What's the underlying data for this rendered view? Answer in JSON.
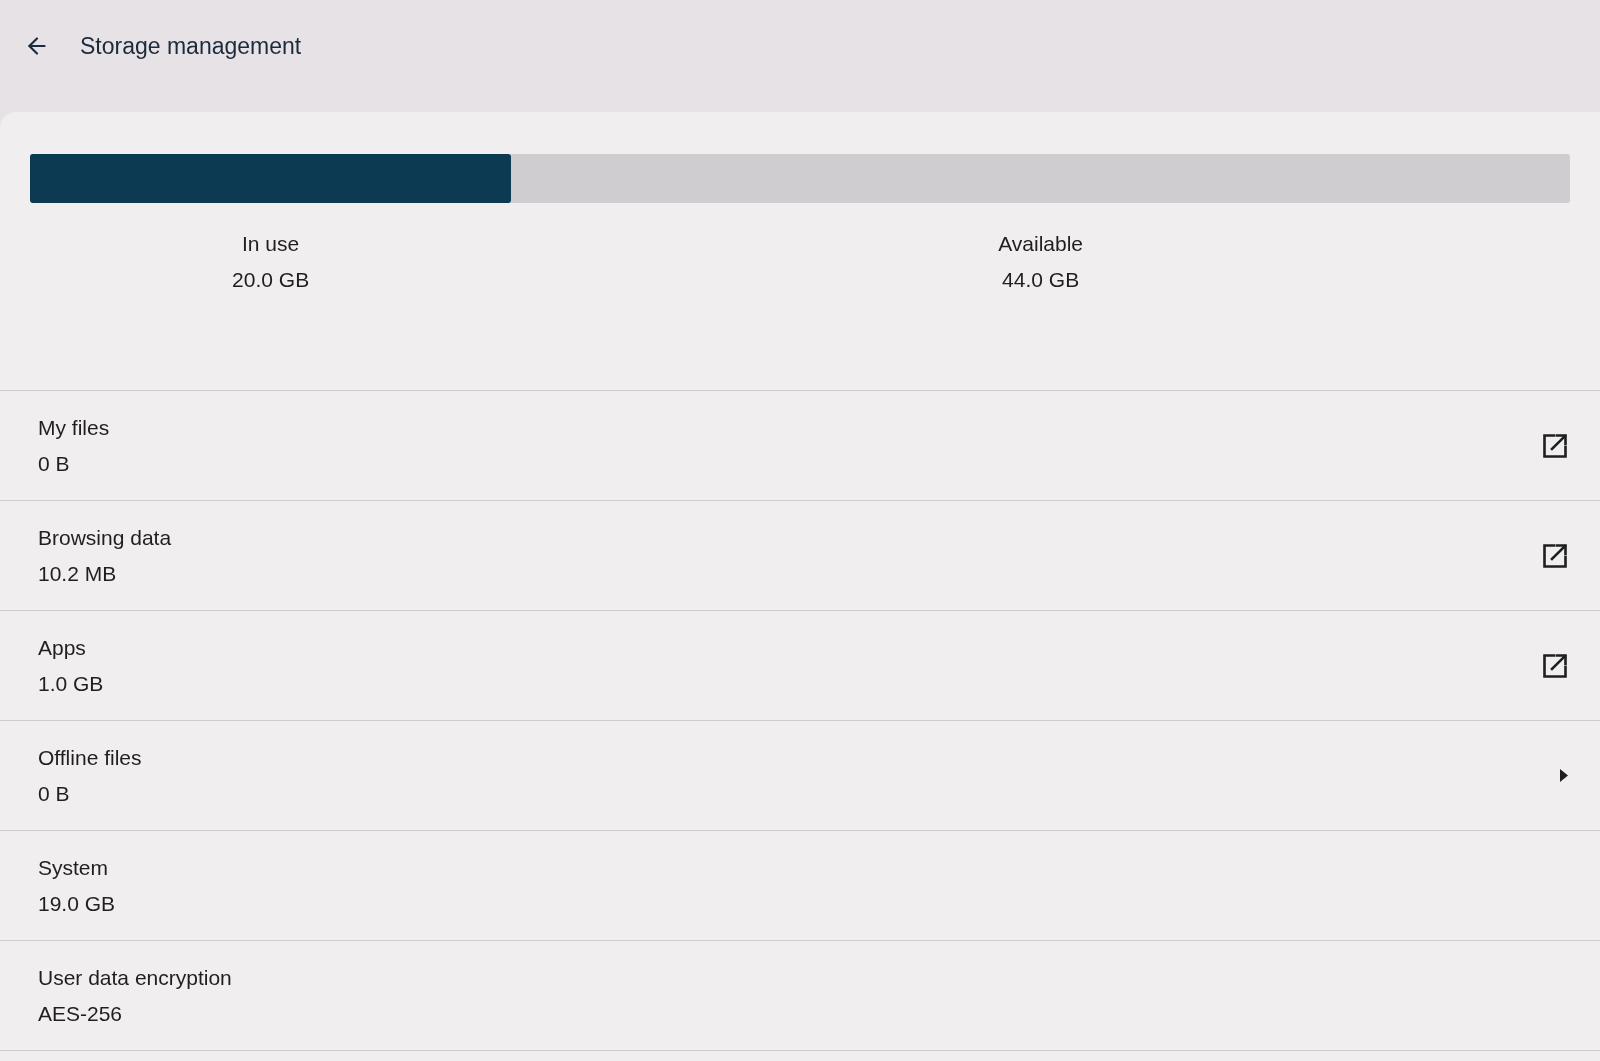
{
  "header": {
    "title": "Storage management"
  },
  "usage_bar": {
    "level": 0.3125,
    "segments": [
      {
        "label": "In use",
        "value": "20.0 GB"
      },
      {
        "label": "Available",
        "value": "44.0 GB"
      }
    ]
  },
  "items": [
    {
      "kind": "external",
      "title": "My files",
      "value": "0 B"
    },
    {
      "kind": "external",
      "title": "Browsing data",
      "value": "10.2 MB"
    },
    {
      "kind": "external",
      "title": "Apps",
      "value": "1.0 GB"
    },
    {
      "kind": "submenu",
      "title": "Offline files",
      "value": "0 B"
    },
    {
      "kind": "plain",
      "title": "System",
      "value": "19.0 GB"
    },
    {
      "kind": "plain",
      "title": "User data encryption",
      "value": "AES-256"
    }
  ]
}
